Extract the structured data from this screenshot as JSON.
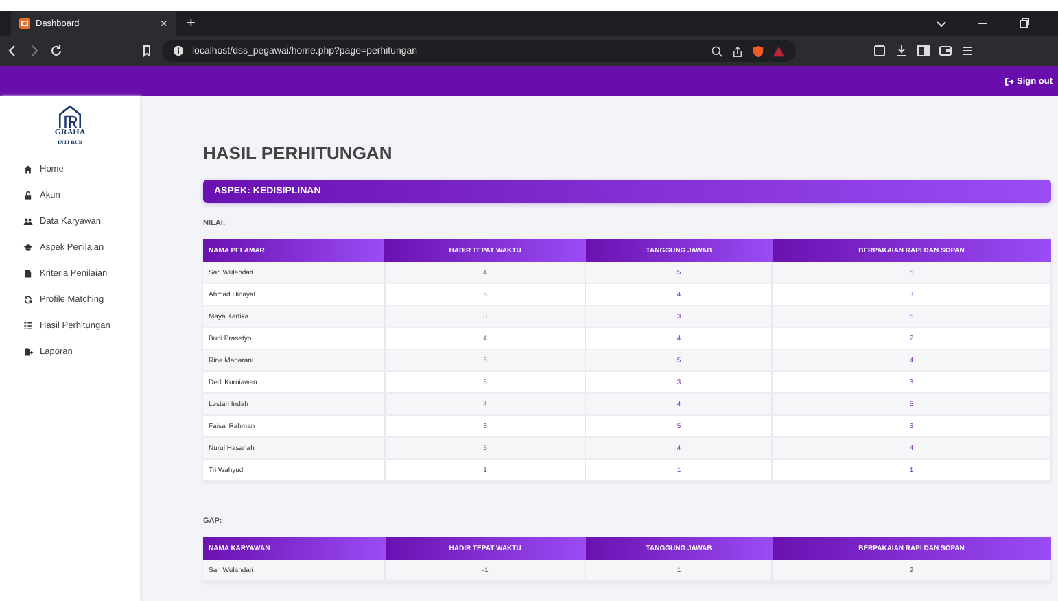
{
  "browser": {
    "tab_title": "Dashboard",
    "new_tab": "+",
    "close_tab": "×",
    "url": "localhost/dss_pegawai/home.php?page=perhitungan"
  },
  "header": {
    "sign_out": "Sign out"
  },
  "logo": {
    "name": "GRAHA",
    "subtitle": "INTI RUB"
  },
  "sidebar": {
    "items": [
      {
        "label": "Home",
        "kind": "home"
      },
      {
        "label": "Akun",
        "kind": "lock"
      },
      {
        "label": "Data Karyawan",
        "kind": "users"
      },
      {
        "label": "Aspek Penilaian",
        "kind": "cap"
      },
      {
        "label": "Kriteria Penilaian",
        "kind": "file"
      },
      {
        "label": "Profile Matching",
        "kind": "sync"
      },
      {
        "label": "Hasil Perhitungan",
        "kind": "list"
      },
      {
        "label": "Laporan",
        "kind": "export"
      }
    ]
  },
  "page_title": "HASIL PERHITUNGAN",
  "aspect": "ASPEK: KEDISIPLINAN",
  "tables": [
    {
      "caption": "NILAI:",
      "columns": [
        "NAMA PELAMAR",
        "HADIR TEPAT WAKTU",
        "TANGGUNG JAWAB",
        "BERPAKAIAN RAPI DAN SOPAN"
      ],
      "rows": [
        [
          "Sari Wulandari",
          "4",
          "5",
          "5"
        ],
        [
          "Ahmad Hidayat",
          "5",
          "4",
          "3"
        ],
        [
          "Maya Kartika",
          "3",
          "3",
          "5"
        ],
        [
          "Budi Prasetyo",
          "4",
          "4",
          "2"
        ],
        [
          "Rina Maharani",
          "5",
          "5",
          "4"
        ],
        [
          "Dedi Kurniawan",
          "5",
          "3",
          "3"
        ],
        [
          "Lestari Indah",
          "4",
          "4",
          "5"
        ],
        [
          "Faisal Rahman",
          "3",
          "5",
          "3"
        ],
        [
          "Nurul Hasanah",
          "5",
          "4",
          "4"
        ],
        [
          "Tri Wahyudi",
          "1",
          "1",
          "1"
        ]
      ]
    },
    {
      "caption": "GAP:",
      "columns": [
        "NAMA KARYAWAN",
        "HADIR TEPAT WAKTU",
        "TANGGUNG JAWAB",
        "BERPAKAIAN RAPI DAN SOPAN"
      ],
      "rows": [
        [
          "Sari Wulandari",
          "-1",
          "1",
          "2"
        ]
      ]
    }
  ]
}
